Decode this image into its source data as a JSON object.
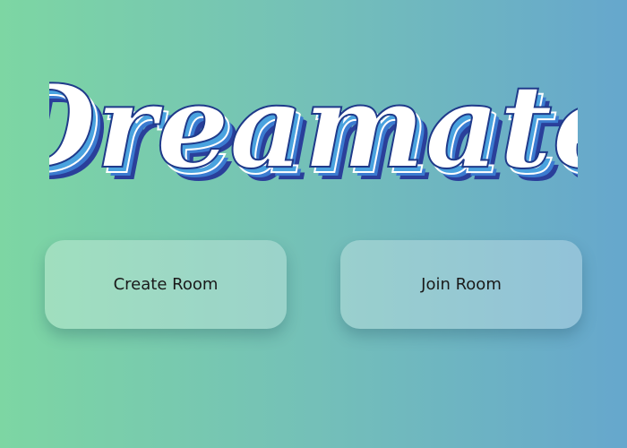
{
  "logo": {
    "text": "Dreamate",
    "colors": {
      "fill": "#ffffff",
      "outline": "#1f3a8a",
      "layer1": "#4aa3df",
      "layer2": "#3b7bd0",
      "layer3": "#2a3f9a"
    }
  },
  "buttons": {
    "create_label": "Create Room",
    "join_label": "Join Room"
  },
  "background": {
    "left": "#7dd6a3",
    "right": "#66a7cd"
  }
}
